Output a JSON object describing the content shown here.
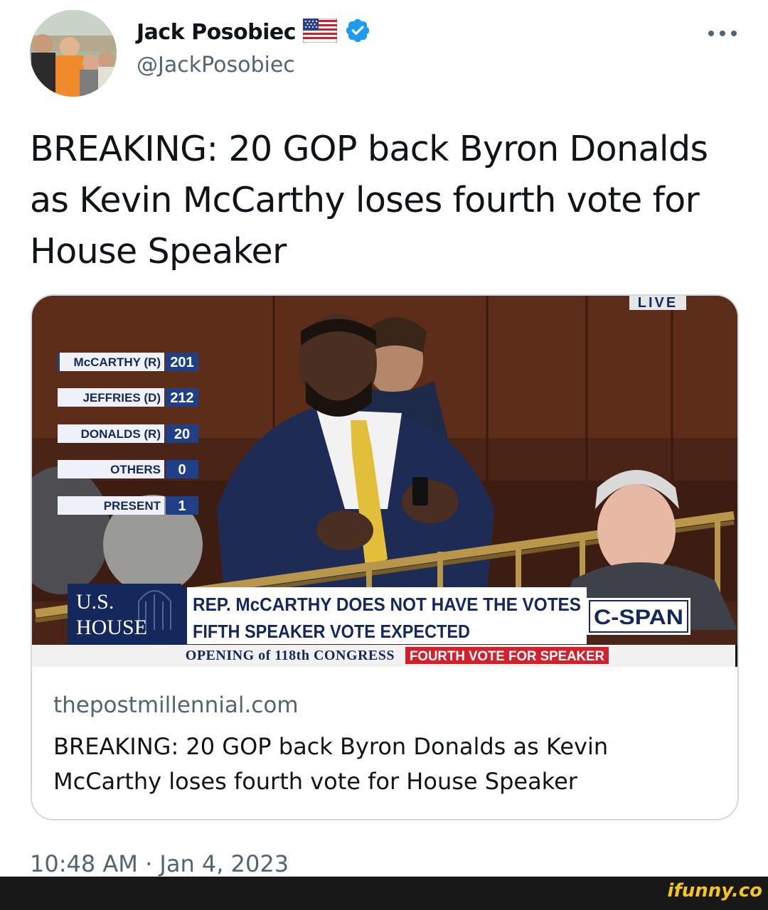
{
  "author": {
    "name": "Jack Posobiec",
    "handle": "@JackPosobiec",
    "flag_icon": "us-flag-icon",
    "verified_icon": "verified-badge-icon"
  },
  "more_icon": "more-options-icon",
  "tweet": {
    "text": "BREAKING: 20 GOP back Byron Donalds as Kevin McCarthy loses fourth vote for House Speaker",
    "timestamp": "10:48 AM · Jan 4, 2023"
  },
  "card": {
    "domain": "thepostmillennial.com",
    "title": "BREAKING: 20 GOP back Byron Donalds as Kevin McCarthy loses fourth vote for House Speaker",
    "media": {
      "live_label": "LIVE",
      "vote_tally": [
        {
          "label": "McCARTHY (R)",
          "count": "201"
        },
        {
          "label": "JEFFRIES (D)",
          "count": "212"
        },
        {
          "label": "DONALDS (R)",
          "count": "20"
        },
        {
          "label": "OTHERS",
          "count": "0"
        },
        {
          "label": "PRESENT",
          "count": "1"
        }
      ],
      "house_logo_line1": "U.S.",
      "house_logo_line2": "HOUSE",
      "headline_line1": "REP. McCARTHY DOES NOT HAVE THE VOTES",
      "headline_line2": "FIFTH SPEAKER VOTE EXPECTED",
      "network_logo": "C-SPAN",
      "ticker_left": "OPENING of 118th CONGRESS",
      "ticker_right": "FOURTH VOTE FOR SPEAKER"
    }
  },
  "watermark": "ifunny.co",
  "colors": {
    "text_primary": "#0f1419",
    "text_secondary": "#536471",
    "verified_blue": "#1d9bf0",
    "card_border": "#cfd9de",
    "tally_count_bg": "#1f3f86",
    "ticker_red": "#d3202b",
    "chyron_navy": "#14285c"
  }
}
